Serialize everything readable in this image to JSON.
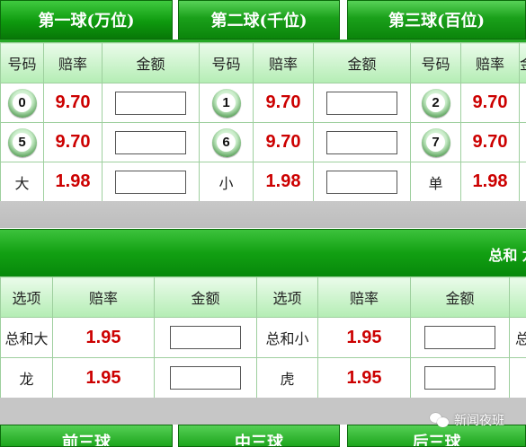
{
  "top_tabs": [
    {
      "label": "第一球(万位)",
      "active": true
    },
    {
      "label": "第二球(千位)",
      "active": false
    },
    {
      "label": "第三球(百位)",
      "active": false
    }
  ],
  "ball_table": {
    "headers": [
      "号码",
      "赔率",
      "金额"
    ],
    "rows": [
      [
        {
          "ball": "0",
          "odds": "9.70"
        },
        {
          "ball": "1",
          "odds": "9.70"
        },
        {
          "ball": "2",
          "odds": "9.70"
        }
      ],
      [
        {
          "ball": "5",
          "odds": "9.70"
        },
        {
          "ball": "6",
          "odds": "9.70"
        },
        {
          "ball": "7",
          "odds": "9.70"
        }
      ],
      [
        {
          "label": "大",
          "odds": "1.98"
        },
        {
          "label": "小",
          "odds": "1.98"
        },
        {
          "label": "单",
          "odds": "1.98"
        }
      ]
    ]
  },
  "section2": {
    "banner_title": "总和  龙",
    "headers": [
      "选项",
      "赔率",
      "金额"
    ],
    "rows": [
      [
        {
          "label": "总和大",
          "odds": "1.95"
        },
        {
          "label": "总和小",
          "odds": "1.95"
        },
        {
          "label": "总"
        }
      ],
      [
        {
          "label": "龙",
          "odds": "1.95"
        },
        {
          "label": "虎",
          "odds": "1.95"
        }
      ]
    ]
  },
  "bottom_tabs": [
    "前三球",
    "中三球",
    "后三球"
  ],
  "watermark": {
    "icon": "wechat-icon",
    "text": "新闻夜班"
  },
  "colors": {
    "odds": "#cc0000",
    "tab_green": "#1aa01a",
    "header_green": "#b4edb4"
  }
}
